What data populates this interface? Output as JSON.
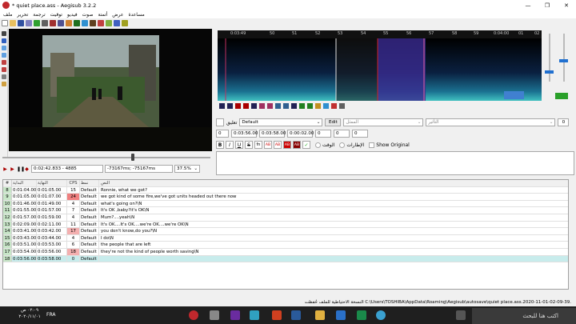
{
  "window": {
    "title": "* quiet place.ass - Aegisub 3.2.2",
    "minimize": "—",
    "maximize": "❐",
    "close": "✕"
  },
  "menu": [
    "ملف",
    "تحرير",
    "ترجمة",
    "توقيت",
    "فيديو",
    "صوت",
    "أتمتة",
    "عرض",
    "مساعدة"
  ],
  "audio": {
    "ticks": [
      "0:03:49",
      "50",
      "51",
      "52",
      "53",
      "54",
      "55",
      "56",
      "57",
      "58",
      "59",
      "0:04:00",
      "01",
      "02"
    ]
  },
  "video": {
    "time": "0:02:42.833 - 4885",
    "offset": "-73167ms; -75167ms",
    "zoom": "37.5%"
  },
  "editor": {
    "comment_label": "تعليق",
    "style": "Default",
    "edit_button": "Edit",
    "actor_placeholder": "الممثل",
    "effect_placeholder": "التأثير",
    "layer": "0",
    "start": "0:03:56.00",
    "end": "0:03:58.00",
    "duration": "0:00:02.00",
    "margin_l": "0",
    "margin_r": "0",
    "margin_v": "0",
    "time_label": "الوقت",
    "frames_label": "الإطارات",
    "show_original": "Show Original",
    "fmt_b": "B",
    "fmt_i": "I",
    "fmt_u": "U",
    "fmt_s": "S",
    "fmt_fn": "fn",
    "fmt_ab1": "AB",
    "fmt_ab2": "AB",
    "fmt_ab3": "AB",
    "fmt_ab4": "AB"
  },
  "grid": {
    "headers": {
      "num": "#",
      "start": "البداية",
      "end": "النهاية",
      "cps": "CPS",
      "style": "نمط",
      "text": "النص"
    },
    "rows": [
      {
        "num": "8",
        "start": "0:01:04.00",
        "end": "0:01:05.00",
        "cps": "15",
        "style": "Default",
        "text": "Ronnie, what we got?"
      },
      {
        "num": "9",
        "start": "0:01:05.00",
        "end": "0:01:07.00",
        "cps": "24",
        "style": "Default",
        "text": "we got kind of some fire,we've got units headed out there now"
      },
      {
        "num": "10",
        "start": "0:01:46.00",
        "end": "0:01:49.00",
        "cps": "4",
        "style": "Default",
        "text": "what's going on?\\N"
      },
      {
        "num": "11",
        "start": "0:01:55.00",
        "end": "0:01:57.00",
        "cps": "7",
        "style": "Default",
        "text": "It's OK ,baby?it's OK\\N"
      },
      {
        "num": "12",
        "start": "0:01:57.00",
        "end": "0:01:59.00",
        "cps": "4",
        "style": "Default",
        "text": "Mum?....yeah\\N"
      },
      {
        "num": "13",
        "start": "0:02:09.00",
        "end": "0:02:11.00",
        "cps": "11",
        "style": "Default",
        "text": "It's OK....It's OK....we're OK....we're OK\\N"
      },
      {
        "num": "14",
        "start": "0:03:41.00",
        "end": "0:03:42.00",
        "cps": "17",
        "style": "Default",
        "text": "you don't know,do you?\\N"
      },
      {
        "num": "15",
        "start": "0:03:43.00",
        "end": "0:03:44.00",
        "cps": "4",
        "style": "Default",
        "text": "I do\\N"
      },
      {
        "num": "16",
        "start": "0:03:51.00",
        "end": "0:03:53.00",
        "cps": "6",
        "style": "Default",
        "text": "the people that are left"
      },
      {
        "num": "17",
        "start": "0:03:54.00",
        "end": "0:03:56.00",
        "cps": "18",
        "style": "Default",
        "text": "they're not the kind of people worth saving\\N"
      },
      {
        "num": "18",
        "start": "0:03:56.00",
        "end": "0:03:58.00",
        "cps": "0",
        "style": "Default",
        "text": ""
      }
    ]
  },
  "status": "النسخة الاحتياطية للملف حُفظت C:\\Users\\TOSHIBA\\AppData\\Roaming\\Aegisub\\autosave\\quiet place.ass.2020-11-01-02-09-39.",
  "taskbar": {
    "time": "٠٢:٠٩ ص",
    "date": "٢٠٢٠/١١/٠١",
    "lang": "FRA",
    "search": "اكتب هنا للبحث"
  },
  "colors": {
    "cps_high": "#f08080",
    "cps_mid": "#f4b0b0",
    "active_row": "#c8ecec",
    "num_col": "#c8e6c8"
  }
}
